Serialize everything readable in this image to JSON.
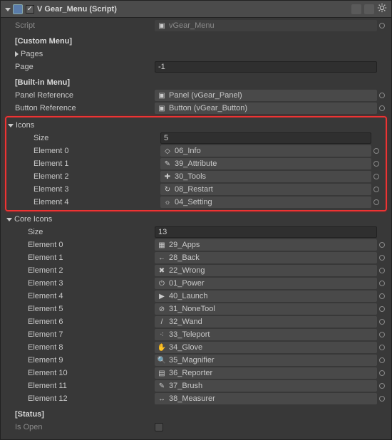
{
  "header": {
    "title": "V Gear_Menu (Script)"
  },
  "script": {
    "label": "Script",
    "value_name": "vGear_Menu"
  },
  "sections": {
    "custom_menu": "[Custom Menu]",
    "built_in_menu": "[Built-in Menu]",
    "status": "[Status]"
  },
  "pages": {
    "label": "Pages"
  },
  "page": {
    "label": "Page",
    "value": "-1"
  },
  "panel_ref": {
    "label": "Panel Reference",
    "value": "Panel (vGear_Panel)",
    "icon": "▣"
  },
  "button_ref": {
    "label": "Button Reference",
    "value": "Button (vGear_Button)",
    "icon": "▣"
  },
  "icons": {
    "label": "Icons",
    "size_label": "Size",
    "size": "5",
    "items": [
      {
        "label": "Element 0",
        "value": "06_Info",
        "icon": "◇"
      },
      {
        "label": "Element 1",
        "value": "39_Attribute",
        "icon": "✎"
      },
      {
        "label": "Element 2",
        "value": "30_Tools",
        "icon": "✚"
      },
      {
        "label": "Element 3",
        "value": "08_Restart",
        "icon": "↻"
      },
      {
        "label": "Element 4",
        "value": "04_Setting",
        "icon": "☼"
      }
    ]
  },
  "core_icons": {
    "label": "Core Icons",
    "size_label": "Size",
    "size": "13",
    "items": [
      {
        "label": "Element 0",
        "value": "29_Apps",
        "icon": "▦"
      },
      {
        "label": "Element 1",
        "value": "28_Back",
        "icon": "←"
      },
      {
        "label": "Element 2",
        "value": "22_Wrong",
        "icon": "✖"
      },
      {
        "label": "Element 3",
        "value": "01_Power",
        "icon": "⏻"
      },
      {
        "label": "Element 4",
        "value": "40_Launch",
        "icon": "▶"
      },
      {
        "label": "Element 5",
        "value": "31_NoneTool",
        "icon": "⊘"
      },
      {
        "label": "Element 6",
        "value": "32_Wand",
        "icon": "/"
      },
      {
        "label": "Element 7",
        "value": "33_Teleport",
        "icon": "⁖"
      },
      {
        "label": "Element 8",
        "value": "34_Glove",
        "icon": "✋"
      },
      {
        "label": "Element 9",
        "value": "35_Magnifier",
        "icon": "🔍"
      },
      {
        "label": "Element 10",
        "value": "36_Reporter",
        "icon": "▤"
      },
      {
        "label": "Element 11",
        "value": "37_Brush",
        "icon": "✎"
      },
      {
        "label": "Element 12",
        "value": "38_Measurer",
        "icon": "↔"
      }
    ]
  },
  "is_open": {
    "label": "Is Open"
  }
}
